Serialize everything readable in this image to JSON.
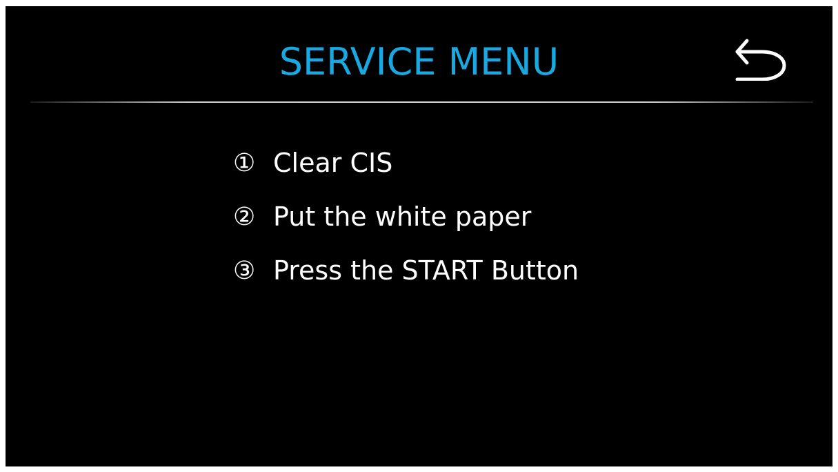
{
  "header": {
    "title": "SERVICE MENU",
    "back_icon": "back-arrow-icon"
  },
  "steps": [
    {
      "number": "①",
      "text": "Clear CIS"
    },
    {
      "number": "②",
      "text": "Put the white paper"
    },
    {
      "number": "③",
      "text": "Press the START Button"
    }
  ],
  "colors": {
    "background": "#000000",
    "title": "#1aa8e0",
    "text": "#ffffff",
    "divider": "#d8d8d8"
  }
}
